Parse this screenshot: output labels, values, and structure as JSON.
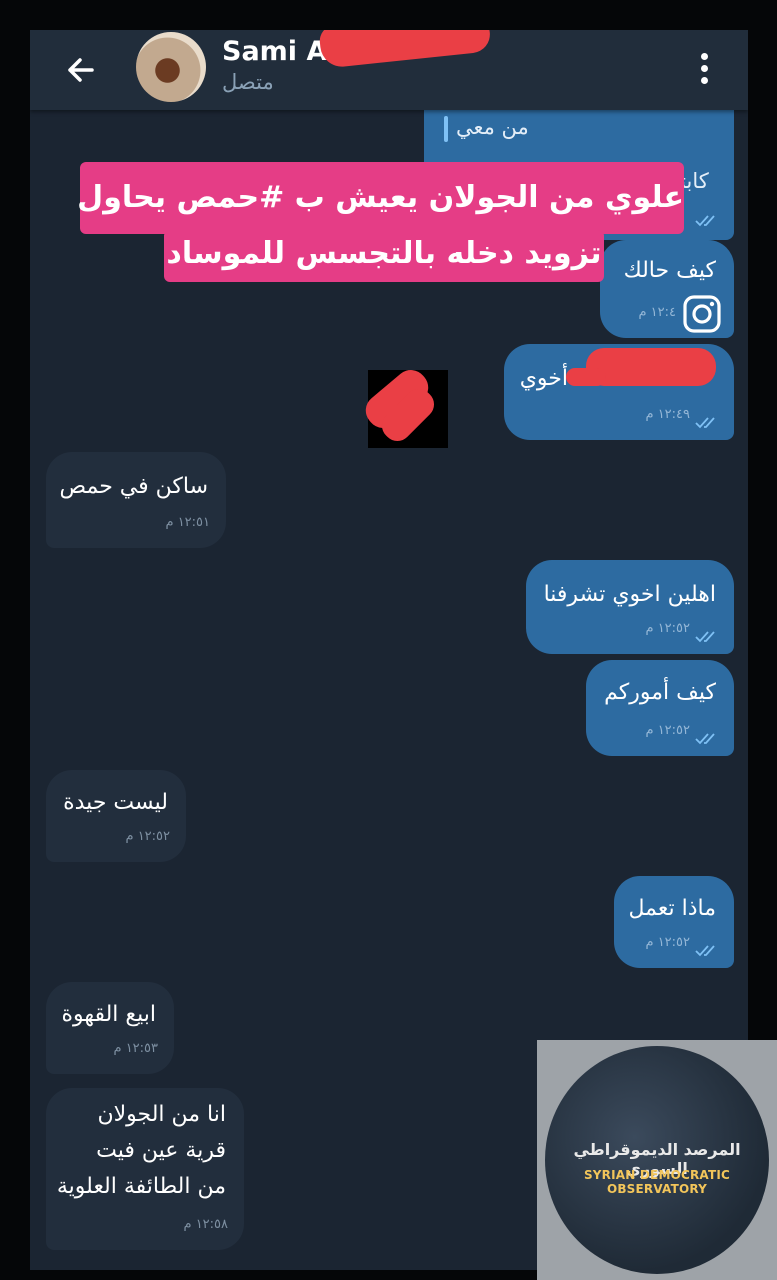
{
  "header": {
    "contact_name": "Sami A",
    "status": "متصل"
  },
  "banner": {
    "line1": "علوي من الجولان يعيش ب #حمص يحاول",
    "line2": "تزويد دخله بالتجسس للموساد"
  },
  "messages": [
    {
      "id": "reply-partial",
      "direction": "out",
      "reply_label": "من معي",
      "text_partial": "كابتـ",
      "time": ""
    },
    {
      "id": "how-are-you",
      "direction": "out",
      "text": "كيف حالك",
      "time": "١٢:٤ م"
    },
    {
      "id": "brother",
      "direction": "out",
      "text": "أخوي",
      "time": "١٢:٤٩ م"
    },
    {
      "id": "live-in-homs",
      "direction": "in",
      "text": "ساكن في حمص",
      "time": "١٢:٥١ م"
    },
    {
      "id": "welcome",
      "direction": "out",
      "text": "اهلين اخوي تشرفنا",
      "time": "١٢:٥٢ م"
    },
    {
      "id": "how-things",
      "direction": "out",
      "text": "كيف أموركم",
      "time": "١٢:٥٢ م"
    },
    {
      "id": "not-good",
      "direction": "in",
      "text": "ليست جيدة",
      "time": "١٢:٥٢ م"
    },
    {
      "id": "what-do",
      "direction": "out",
      "text": "ماذا تعمل",
      "time": "١٢:٥٢ م"
    },
    {
      "id": "sell-coffee",
      "direction": "in",
      "text": "ابيع القهوة",
      "time": "١٢:٥٣ م"
    },
    {
      "id": "from-golan",
      "direction": "in",
      "lines": [
        "انا من الجولان",
        "قرية عين فيت",
        "من الطائفة العلوية"
      ],
      "time": "١٢:٥٨ م"
    }
  ],
  "watermark": {
    "arabic": "المرصد الديموقراطي السوري",
    "english": "SYRIAN DEMOCRATIC OBSERVATORY"
  },
  "colors": {
    "chat_bg": "#1b2532",
    "header_bg": "#212d3b",
    "outgoing_bubble": "#2d6ba1",
    "incoming_bubble": "#222e3d",
    "banner": "#e53d86",
    "redaction": "#ea3f45"
  },
  "icons": [
    "back-arrow-icon",
    "more-vertical-icon",
    "instagram-icon",
    "double-check-icon"
  ]
}
